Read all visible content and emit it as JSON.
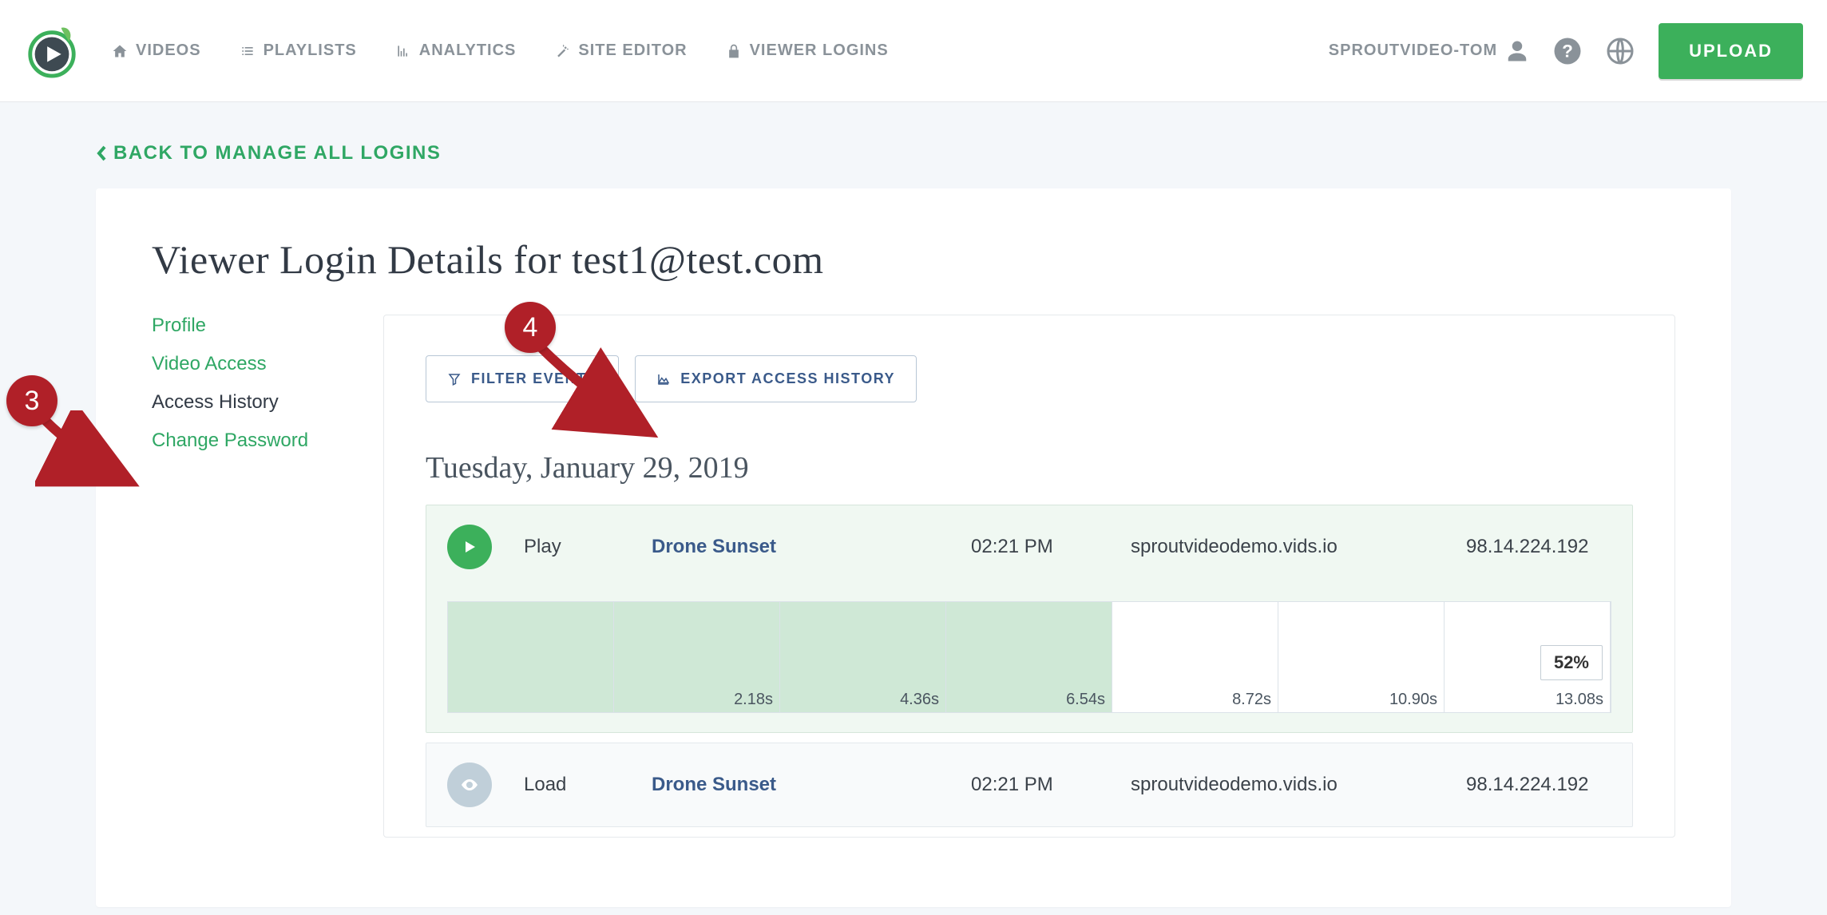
{
  "nav": {
    "videos": "VIDEOS",
    "playlists": "PLAYLISTS",
    "analytics": "ANALYTICS",
    "site_editor": "SITE EDITOR",
    "viewer_logins": "VIEWER LOGINS"
  },
  "user": {
    "name": "SPROUTVIDEO-TOM"
  },
  "upload_label": "UPLOAD",
  "back_link": "BACK TO MANAGE ALL LOGINS",
  "page_title": "Viewer Login Details for test1@test.com",
  "side_tabs": {
    "profile": "Profile",
    "video_access": "Video Access",
    "access_history": "Access History",
    "change_password": "Change Password"
  },
  "actions": {
    "filter": "FILTER EVENTS",
    "export": "EXPORT ACCESS HISTORY"
  },
  "date_heading": "Tuesday, January 29, 2019",
  "events": [
    {
      "type": "Play",
      "title": "Drone Sunset",
      "time": "02:21 PM",
      "domain": "sproutvideodemo.vids.io",
      "ip": "98.14.224.192",
      "progress_label": "52%",
      "timeline": [
        "2.18s",
        "4.36s",
        "6.54s",
        "8.72s",
        "10.90s",
        "13.08s"
      ]
    },
    {
      "type": "Load",
      "title": "Drone Sunset",
      "time": "02:21 PM",
      "domain": "sproutvideodemo.vids.io",
      "ip": "98.14.224.192"
    }
  ],
  "annotations": {
    "step3": "3",
    "step4": "4"
  },
  "chart_data": {
    "type": "bar",
    "description": "Playback engagement timeline for Play event; green segments indicate portions watched.",
    "tick_seconds": [
      0,
      2.18,
      4.36,
      6.54,
      8.72,
      10.9,
      13.08
    ],
    "watched_seconds_range": [
      0,
      8.72
    ],
    "watched_up_to_label": "8.72s",
    "progress_percent": 52,
    "progress_label_position_seconds": 13.08,
    "segments": [
      {
        "end_label": "",
        "watched": true
      },
      {
        "end_label": "2.18s",
        "watched": true
      },
      {
        "end_label": "4.36s",
        "watched": true
      },
      {
        "end_label": "6.54s",
        "watched": true
      },
      {
        "end_label": "8.72s",
        "watched": false
      },
      {
        "end_label": "10.90s",
        "watched": false
      },
      {
        "end_label": "13.08s",
        "watched": false
      }
    ]
  }
}
